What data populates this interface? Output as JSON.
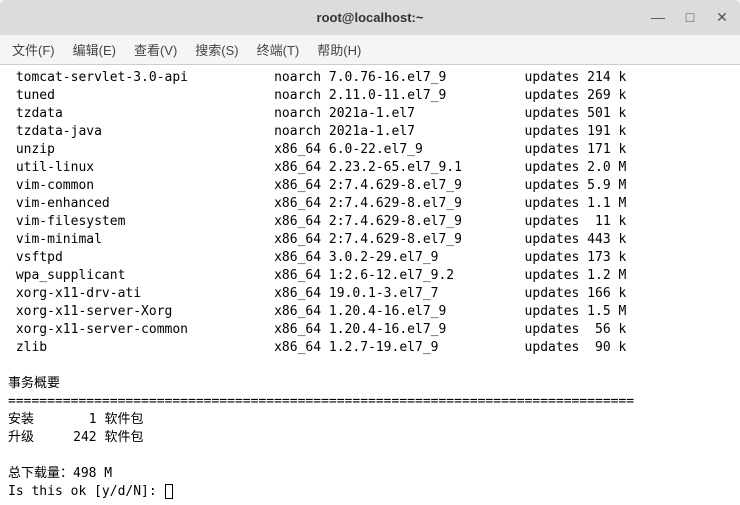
{
  "window": {
    "title": "root@localhost:~",
    "controls": {
      "minimize": "—",
      "maximize": "□",
      "close": "✕"
    }
  },
  "menu": {
    "file": "文件(F)",
    "edit": "编辑(E)",
    "view": "查看(V)",
    "search": "搜索(S)",
    "terminal": "终端(T)",
    "help": "帮助(H)"
  },
  "packages": [
    {
      "name": "tomcat-servlet-3.0-api",
      "arch": "noarch",
      "version": "7.0.76-16.el7_9",
      "repo": "updates",
      "size": "214 k"
    },
    {
      "name": "tuned",
      "arch": "noarch",
      "version": "2.11.0-11.el7_9",
      "repo": "updates",
      "size": "269 k"
    },
    {
      "name": "tzdata",
      "arch": "noarch",
      "version": "2021a-1.el7",
      "repo": "updates",
      "size": "501 k"
    },
    {
      "name": "tzdata-java",
      "arch": "noarch",
      "version": "2021a-1.el7",
      "repo": "updates",
      "size": "191 k"
    },
    {
      "name": "unzip",
      "arch": "x86_64",
      "version": "6.0-22.el7_9",
      "repo": "updates",
      "size": "171 k"
    },
    {
      "name": "util-linux",
      "arch": "x86_64",
      "version": "2.23.2-65.el7_9.1",
      "repo": "updates",
      "size": "2.0 M"
    },
    {
      "name": "vim-common",
      "arch": "x86_64",
      "version": "2:7.4.629-8.el7_9",
      "repo": "updates",
      "size": "5.9 M"
    },
    {
      "name": "vim-enhanced",
      "arch": "x86_64",
      "version": "2:7.4.629-8.el7_9",
      "repo": "updates",
      "size": "1.1 M"
    },
    {
      "name": "vim-filesystem",
      "arch": "x86_64",
      "version": "2:7.4.629-8.el7_9",
      "repo": "updates",
      "size": " 11 k"
    },
    {
      "name": "vim-minimal",
      "arch": "x86_64",
      "version": "2:7.4.629-8.el7_9",
      "repo": "updates",
      "size": "443 k"
    },
    {
      "name": "vsftpd",
      "arch": "x86_64",
      "version": "3.0.2-29.el7_9",
      "repo": "updates",
      "size": "173 k"
    },
    {
      "name": "wpa_supplicant",
      "arch": "x86_64",
      "version": "1:2.6-12.el7_9.2",
      "repo": "updates",
      "size": "1.2 M"
    },
    {
      "name": "xorg-x11-drv-ati",
      "arch": "x86_64",
      "version": "19.0.1-3.el7_7",
      "repo": "updates",
      "size": "166 k"
    },
    {
      "name": "xorg-x11-server-Xorg",
      "arch": "x86_64",
      "version": "1.20.4-16.el7_9",
      "repo": "updates",
      "size": "1.5 M"
    },
    {
      "name": "xorg-x11-server-common",
      "arch": "x86_64",
      "version": "1.20.4-16.el7_9",
      "repo": "updates",
      "size": " 56 k"
    },
    {
      "name": "zlib",
      "arch": "x86_64",
      "version": "1.2.7-19.el7_9",
      "repo": "updates",
      "size": " 90 k"
    }
  ],
  "summary": {
    "heading": "事务概要",
    "divider": "================================================================================",
    "install_label": "安装",
    "install_count": "1",
    "upgrade_label": "升级",
    "upgrade_count": "242",
    "pkg_word": "软件包",
    "download_label": "总下载量：",
    "download_size": "498 M",
    "prompt": "Is this ok [y/d/N]: "
  }
}
